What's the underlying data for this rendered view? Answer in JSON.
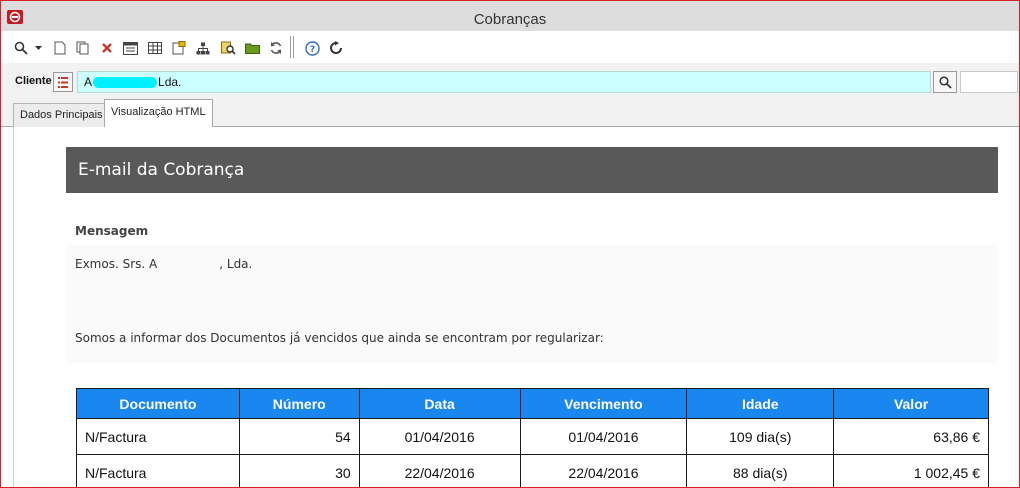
{
  "window": {
    "title": "Cobranças"
  },
  "toolbar": {
    "icons": [
      "search-icon",
      "dropdown-arrow-icon",
      "new-document-icon",
      "copy-document-icon",
      "delete-icon",
      "list-view-icon",
      "grid-view-icon",
      "edit-document-icon",
      "hierarchy-icon",
      "find-document-icon",
      "folder-icon",
      "refresh-icon",
      "help-icon",
      "reload-icon"
    ]
  },
  "client": {
    "label": "Cliente",
    "value_prefix": "A",
    "value_suffix": "Lda."
  },
  "tabs": [
    {
      "label": "Dados Principais",
      "active": false
    },
    {
      "label": "Visualização HTML",
      "active": true
    }
  ],
  "email": {
    "header": "E-mail da Cobrança",
    "message_title": "Mensagem",
    "greeting_prefix": "Exmos. Srs. A",
    "greeting_suffix": ", Lda.",
    "intro": "Somos a informar dos Documentos já vencidos que ainda se encontram por regularizar:"
  },
  "table": {
    "headers": [
      "Documento",
      "Número",
      "Data",
      "Vencimento",
      "Idade",
      "Valor"
    ],
    "rows": [
      [
        "N/Factura",
        "54",
        "01/04/2016",
        "01/04/2016",
        "109 dia(s)",
        "63,86 €"
      ],
      [
        "N/Factura",
        "30",
        "22/04/2016",
        "22/04/2016",
        "88 dia(s)",
        "1 002,45 €"
      ]
    ]
  },
  "colors": {
    "accent_header": "#1a86f0",
    "email_header_bg": "#595959",
    "client_field_bg": "#ccffff",
    "window_border": "#d9202a"
  }
}
